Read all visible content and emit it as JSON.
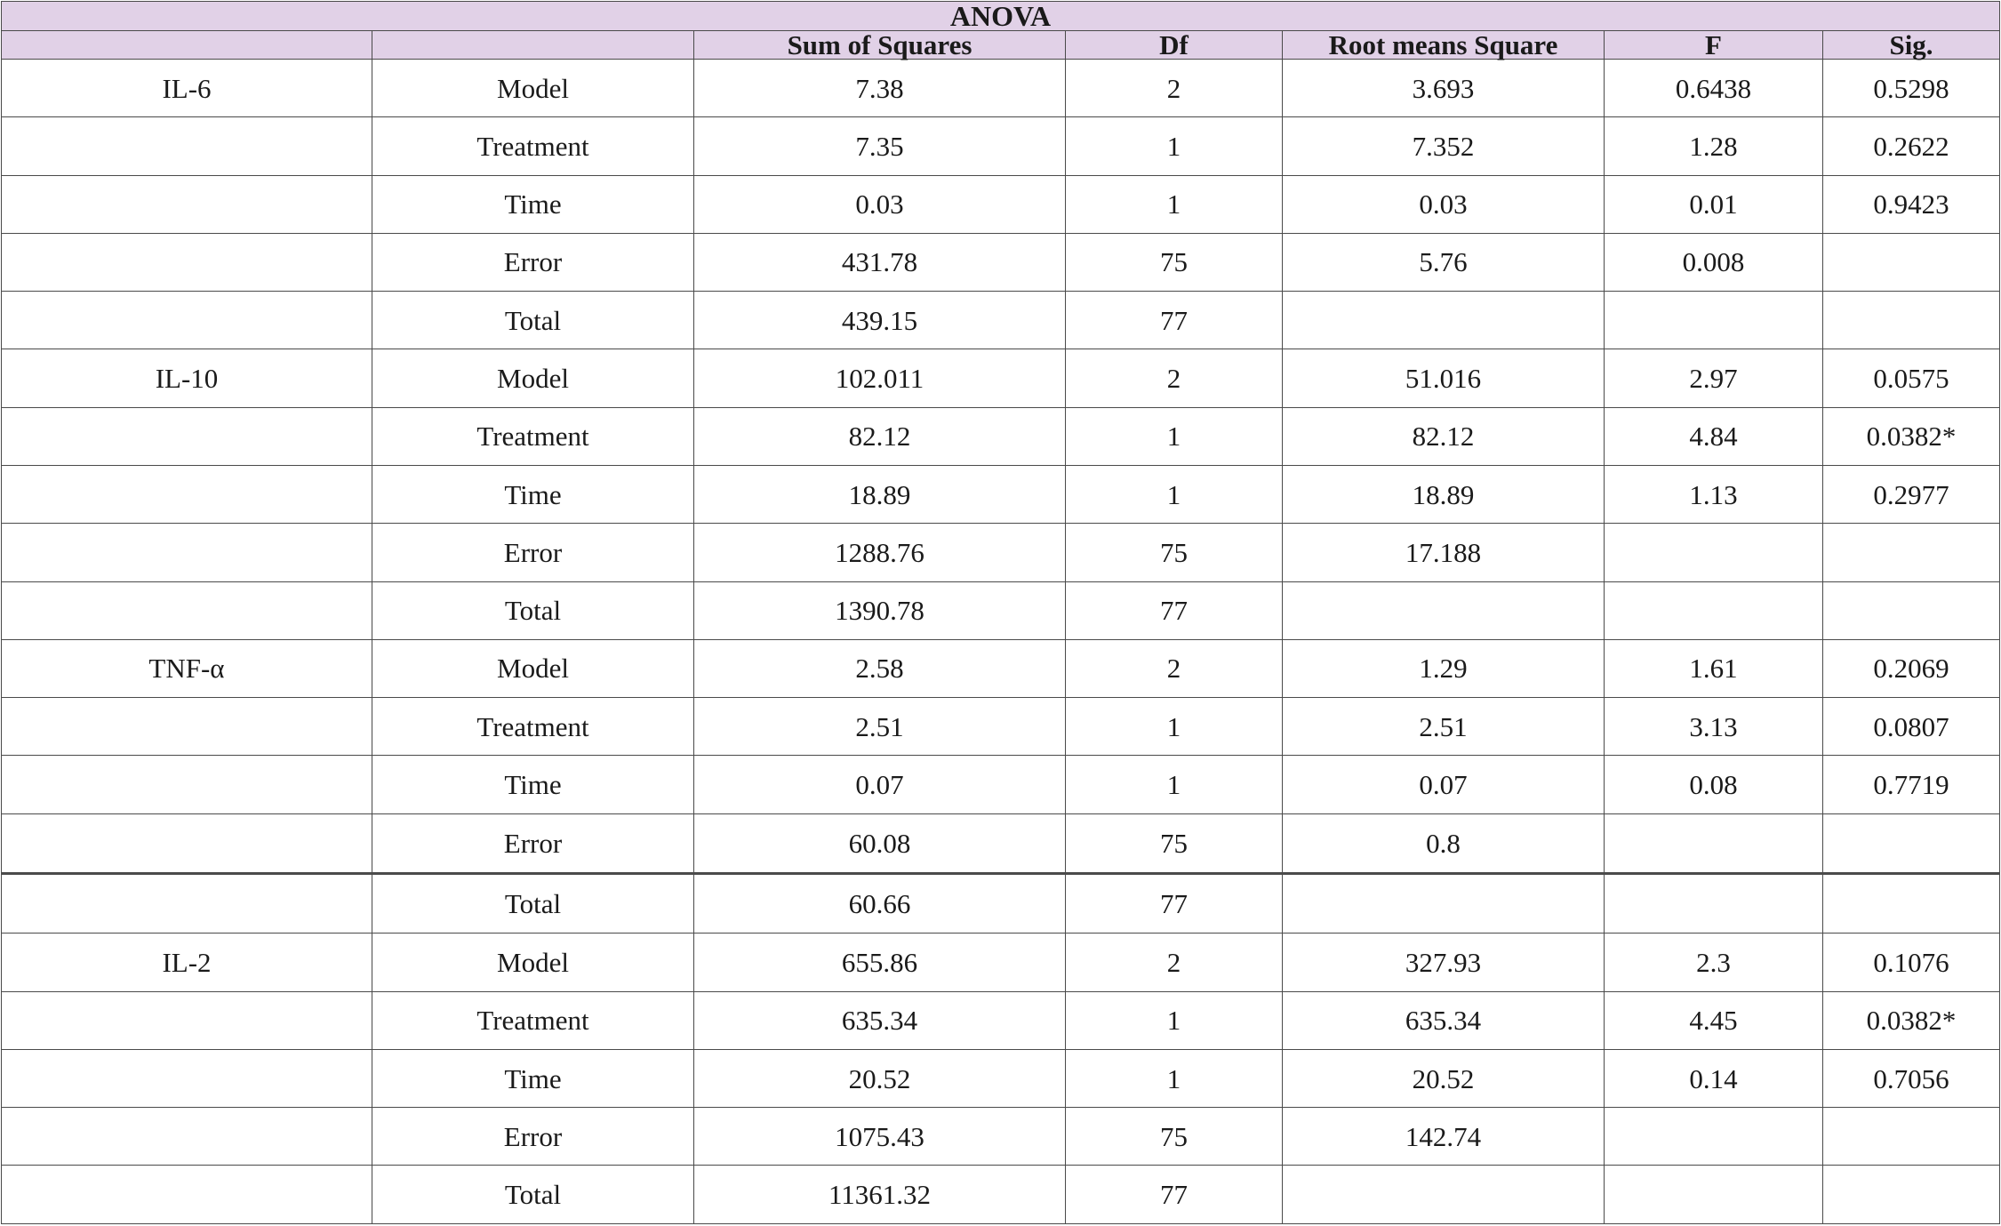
{
  "table": {
    "title": "ANOVA",
    "columns": [
      "",
      "",
      "Sum of Squares",
      "Df",
      "Root means Square",
      "F",
      "Sig."
    ],
    "rows": [
      {
        "group": "IL-6",
        "source": "Model",
        "ss": "7.38",
        "df": "2",
        "rms": "3.693",
        "f": "0.6438",
        "sig": "0.5298"
      },
      {
        "group": "",
        "source": "Treatment",
        "ss": "7.35",
        "df": "1",
        "rms": "7.352",
        "f": "1.28",
        "sig": "0.2622"
      },
      {
        "group": "",
        "source": "Time",
        "ss": "0.03",
        "df": "1",
        "rms": "0.03",
        "f": "0.01",
        "sig": "0.9423"
      },
      {
        "group": "",
        "source": "Error",
        "ss": "431.78",
        "df": "75",
        "rms": "5.76",
        "f": "0.008",
        "sig": ""
      },
      {
        "group": "",
        "source": "Total",
        "ss": "439.15",
        "df": "77",
        "rms": "",
        "f": "",
        "sig": ""
      },
      {
        "group": "IL-10",
        "source": "Model",
        "ss": "102.011",
        "df": "2",
        "rms": "51.016",
        "f": "2.97",
        "sig": "0.0575"
      },
      {
        "group": "",
        "source": "Treatment",
        "ss": "82.12",
        "df": "1",
        "rms": "82.12",
        "f": "4.84",
        "sig": "0.0382*"
      },
      {
        "group": "",
        "source": "Time",
        "ss": "18.89",
        "df": "1",
        "rms": "18.89",
        "f": "1.13",
        "sig": "0.2977"
      },
      {
        "group": "",
        "source": "Error",
        "ss": "1288.76",
        "df": "75",
        "rms": "17.188",
        "f": "",
        "sig": ""
      },
      {
        "group": "",
        "source": "Total",
        "ss": "1390.78",
        "df": "77",
        "rms": "",
        "f": "",
        "sig": ""
      },
      {
        "group": "TNF-α",
        "source": "Model",
        "ss": "2.58",
        "df": "2",
        "rms": "1.29",
        "f": "1.61",
        "sig": "0.2069"
      },
      {
        "group": "",
        "source": "Treatment",
        "ss": "2.51",
        "df": "1",
        "rms": "2.51",
        "f": "3.13",
        "sig": "0.0807"
      },
      {
        "group": "",
        "source": "Time",
        "ss": "0.07",
        "df": "1",
        "rms": "0.07",
        "f": "0.08",
        "sig": "0.7719"
      },
      {
        "group": "",
        "source": "Error",
        "ss": "60.08",
        "df": "75",
        "rms": "0.8",
        "f": "",
        "sig": ""
      },
      {
        "group": "",
        "source": "Total",
        "ss": "60.66",
        "df": "77",
        "rms": "",
        "f": "",
        "sig": ""
      },
      {
        "group": "IL-2",
        "source": "Model",
        "ss": "655.86",
        "df": "2",
        "rms": "327.93",
        "f": "2.3",
        "sig": "0.1076"
      },
      {
        "group": "",
        "source": "Treatment",
        "ss": "635.34",
        "df": "1",
        "rms": "635.34",
        "f": "4.45",
        "sig": "0.0382*"
      },
      {
        "group": "",
        "source": "Time",
        "ss": "20.52",
        "df": "1",
        "rms": "20.52",
        "f": "0.14",
        "sig": "0.7056"
      },
      {
        "group": "",
        "source": "Error",
        "ss": "1075.43",
        "df": "75",
        "rms": "142.74",
        "f": "",
        "sig": ""
      },
      {
        "group": "",
        "source": "Total",
        "ss": "11361.32",
        "df": "77",
        "rms": "",
        "f": "",
        "sig": ""
      }
    ]
  },
  "colors": {
    "header_bg": "#e1d1e7",
    "border": "#4a4a4a"
  }
}
